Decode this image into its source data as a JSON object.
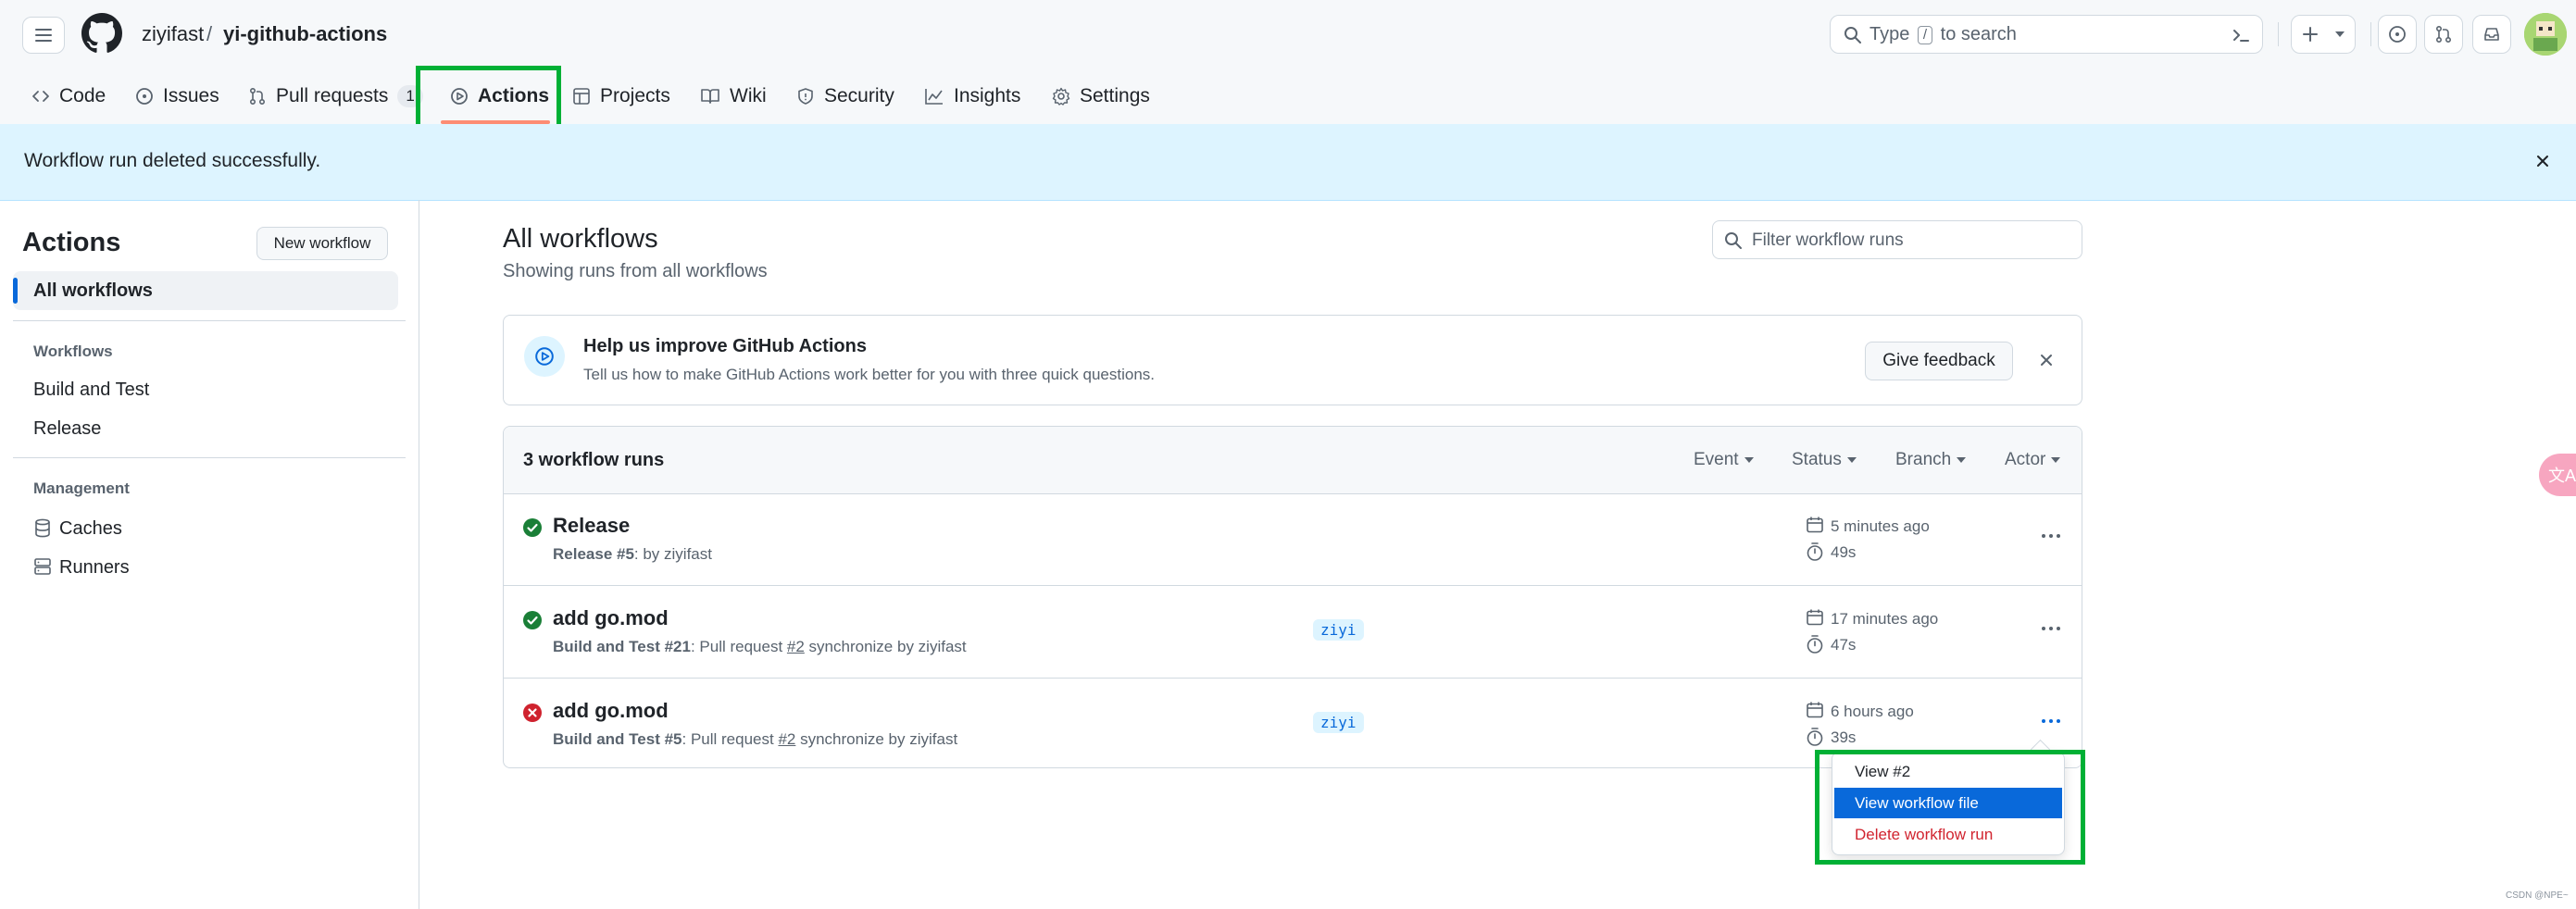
{
  "header": {
    "owner": "ziyifast",
    "separator": "/",
    "repo": "yi-github-actions",
    "search_prefix": "Type",
    "search_key": "/",
    "search_suffix": "to search"
  },
  "nav": {
    "code": "Code",
    "issues": "Issues",
    "pull_requests": "Pull requests",
    "pull_requests_count": "1",
    "actions": "Actions",
    "projects": "Projects",
    "wiki": "Wiki",
    "security": "Security",
    "insights": "Insights",
    "settings": "Settings"
  },
  "flash": {
    "message": "Workflow run deleted successfully."
  },
  "sidebar": {
    "title": "Actions",
    "new_workflow": "New workflow",
    "all_workflows": "All workflows",
    "workflows_heading": "Workflows",
    "workflows": [
      "Build and Test",
      "Release"
    ],
    "management_heading": "Management",
    "caches": "Caches",
    "runners": "Runners"
  },
  "main": {
    "title": "All workflows",
    "subtitle": "Showing runs from all workflows",
    "filter_placeholder": "Filter workflow runs"
  },
  "feedback": {
    "title": "Help us improve GitHub Actions",
    "subtitle": "Tell us how to make GitHub Actions work better for you with three quick questions.",
    "button": "Give feedback"
  },
  "runs": {
    "count_label": "3 workflow runs",
    "filters": [
      "Event",
      "Status",
      "Branch",
      "Actor"
    ],
    "items": [
      {
        "status": "success",
        "title": "Release",
        "workflow": "Release #5",
        "meta_mid": ": by ziyifast",
        "pr_link": "",
        "meta_tail": "",
        "branch": "",
        "time": "5 minutes ago",
        "duration": "49s"
      },
      {
        "status": "success",
        "title": "add go.mod",
        "workflow": "Build and Test #21",
        "meta_mid": ": Pull request ",
        "pr_link": "#2",
        "meta_tail": " synchronize by ziyifast",
        "branch": "ziyi",
        "time": "17 minutes ago",
        "duration": "47s"
      },
      {
        "status": "failure",
        "title": "add go.mod",
        "workflow": "Build and Test #5",
        "meta_mid": ": Pull request ",
        "pr_link": "#2",
        "meta_tail": " synchronize by ziyifast",
        "branch": "ziyi",
        "time": "6 hours ago",
        "duration": "39s"
      }
    ]
  },
  "menu": {
    "items": [
      "View #2",
      "View workflow file",
      "Delete workflow run"
    ]
  },
  "extras": {
    "translate_badge": "文A",
    "watermark": "CSDN @NPE~"
  },
  "colors": {
    "success": "#1a7f37",
    "failure": "#cf222e",
    "accent": "#0969da",
    "highlight": "#00b035",
    "tab_underline": "#fd8c73"
  }
}
